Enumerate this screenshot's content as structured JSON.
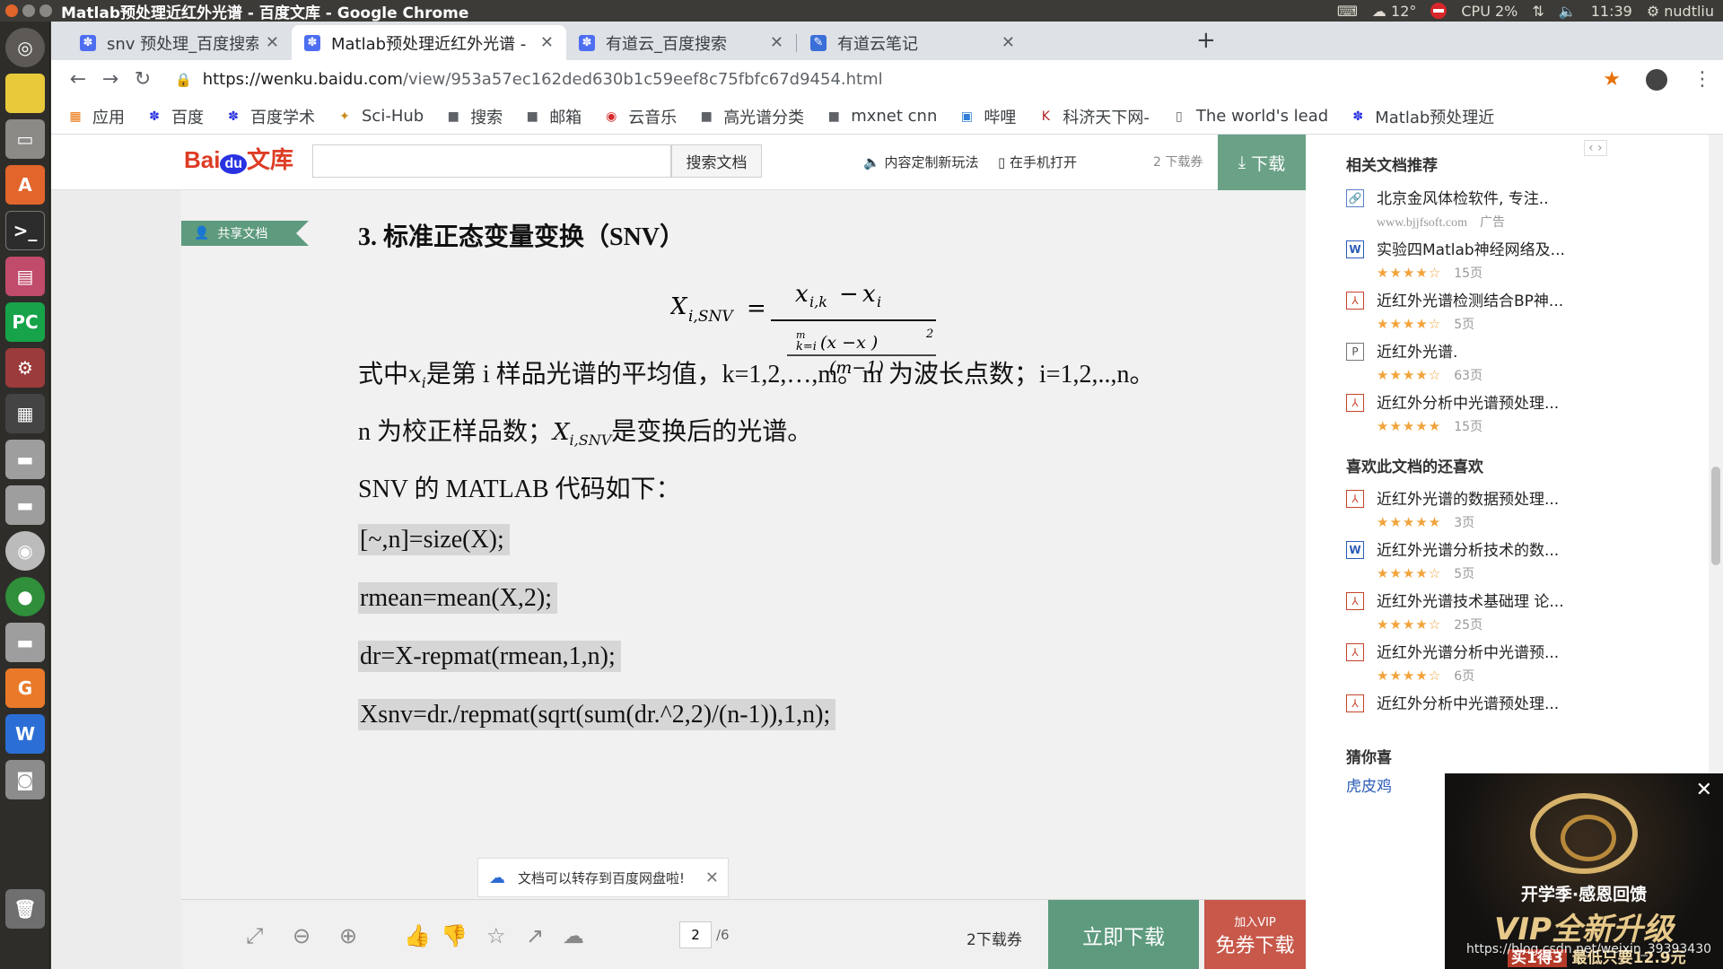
{
  "os": {
    "window_title": "Matlab预处理近红外光谱 - 百度文库 - Google Chrome",
    "temperature": "12°",
    "cpu": "CPU 2%",
    "time": "11:39",
    "user": "nudtliu"
  },
  "launcher": {
    "items": [
      "ubuntu-dash-icon",
      "notes-icon",
      "files-icon",
      "software-center-icon",
      "terminal-icon",
      "browser-window-icon",
      "pycharm-icon",
      "settings-icon",
      "workspace-icon",
      "drive-icon",
      "drive2-icon",
      "disc-icon",
      "chrome-icon",
      "drive3-icon",
      "pdf-icon",
      "wps-icon",
      "camera-icon",
      "trash-icon"
    ]
  },
  "tabs": [
    {
      "title": "snv   预处理_百度搜索"
    },
    {
      "title": "Matlab预处理近红外光谱 -"
    },
    {
      "title": "有道云_百度搜索"
    },
    {
      "title": "有道云笔记"
    }
  ],
  "toolbar": {
    "url_host": "https://wenku.baidu.com",
    "url_path": "/view/953a57ec162ded630b1c59eef8c75fbfc67d9454.html"
  },
  "bookmarks": [
    "应用",
    "百度",
    "百度学术",
    "Sci-Hub",
    "搜索",
    "邮箱",
    "云音乐",
    "高光谱分类",
    "mxnet cnn",
    "哔哩",
    "科济天下网-",
    "The world's lead",
    "Matlab预处理近"
  ],
  "header": {
    "logo_text": "Bai",
    "logo_du": "du",
    "logo_suffix": "文库",
    "search_button": "搜索文档",
    "link_custom": "内容定制新玩法",
    "link_mobile": "在手机打开",
    "coupon": "2 下载券",
    "download": "下载"
  },
  "doc": {
    "share_tag": "共享文档",
    "section_title": "3.  标准正态变量变换（SNV）",
    "para1_a": "式中",
    "para1_b": "是第 i 样品光谱的平均值，k=1,2,…,m。m 为波长点数；i=1,2,..,n。",
    "para2_a": "n 为校正样品数；",
    "para2_b": "是变换后的光谱。",
    "para3": "SNV 的 MATLAB  代码如下：",
    "code": [
      "[~,n]=size(X);",
      "rmean=mean(X,2);",
      "dr=X-repmat(rmean,1,n);",
      "Xsnv=dr./repmat(sqrt(sum(dr.^2,2)/(n-1)),1,n);"
    ]
  },
  "toast": {
    "text": "文档可以转存到百度网盘啦!"
  },
  "bottom": {
    "page": "2",
    "total": "/6",
    "coupon": "2下载券",
    "download_now": "立即下载",
    "vip_small": "加入VIP",
    "vip_big": "免券下载"
  },
  "sidebar": {
    "related_heading": "相关文档推荐",
    "related": [
      {
        "icon": "link",
        "title": "北京金风体检软件, 专注..",
        "meta1": "www.bjjfsoft.com",
        "meta2": "广告"
      },
      {
        "icon": "word",
        "title": "实验四Matlab神经网络及...",
        "stars": "★★★★☆",
        "pages": "15页"
      },
      {
        "icon": "pdf",
        "title": "近红外光谱检测结合BP神...",
        "stars": "★★★★☆",
        "pages": "5页"
      },
      {
        "icon": "ppt",
        "title": "近红外光谱.",
        "stars": "★★★★☆",
        "pages": "63页"
      },
      {
        "icon": "pdf",
        "title": "近红外分析中光谱预处理...",
        "stars": "★★★★★",
        "pages": "15页"
      }
    ],
    "liked_heading": "喜欢此文档的还喜欢",
    "liked": [
      {
        "icon": "pdf",
        "title": "近红外光谱的数据预处理...",
        "stars": "★★★★★",
        "pages": "3页"
      },
      {
        "icon": "word",
        "title": "近红外光谱分析技术的数...",
        "stars": "★★★★☆",
        "pages": "5页"
      },
      {
        "icon": "pdf",
        "title": "近红外光谱技术基础理 论...",
        "stars": "★★★★☆",
        "pages": "25页"
      },
      {
        "icon": "pdf",
        "title": "近红外光谱分析中光谱预...",
        "stars": "★★★★☆",
        "pages": "6页"
      },
      {
        "icon": "pdf",
        "title": "近红外分析中光谱预处理..."
      }
    ],
    "guess_heading": "猜你喜",
    "guess_item": "虎皮鸡"
  },
  "ad": {
    "line1": "开学季·感恩回馈",
    "line2": "VIP全新升级",
    "tag": "买1得3",
    "line3": "最低只要12.9元"
  },
  "watermark": "https://blog.csdn.net/weixin_39393430"
}
